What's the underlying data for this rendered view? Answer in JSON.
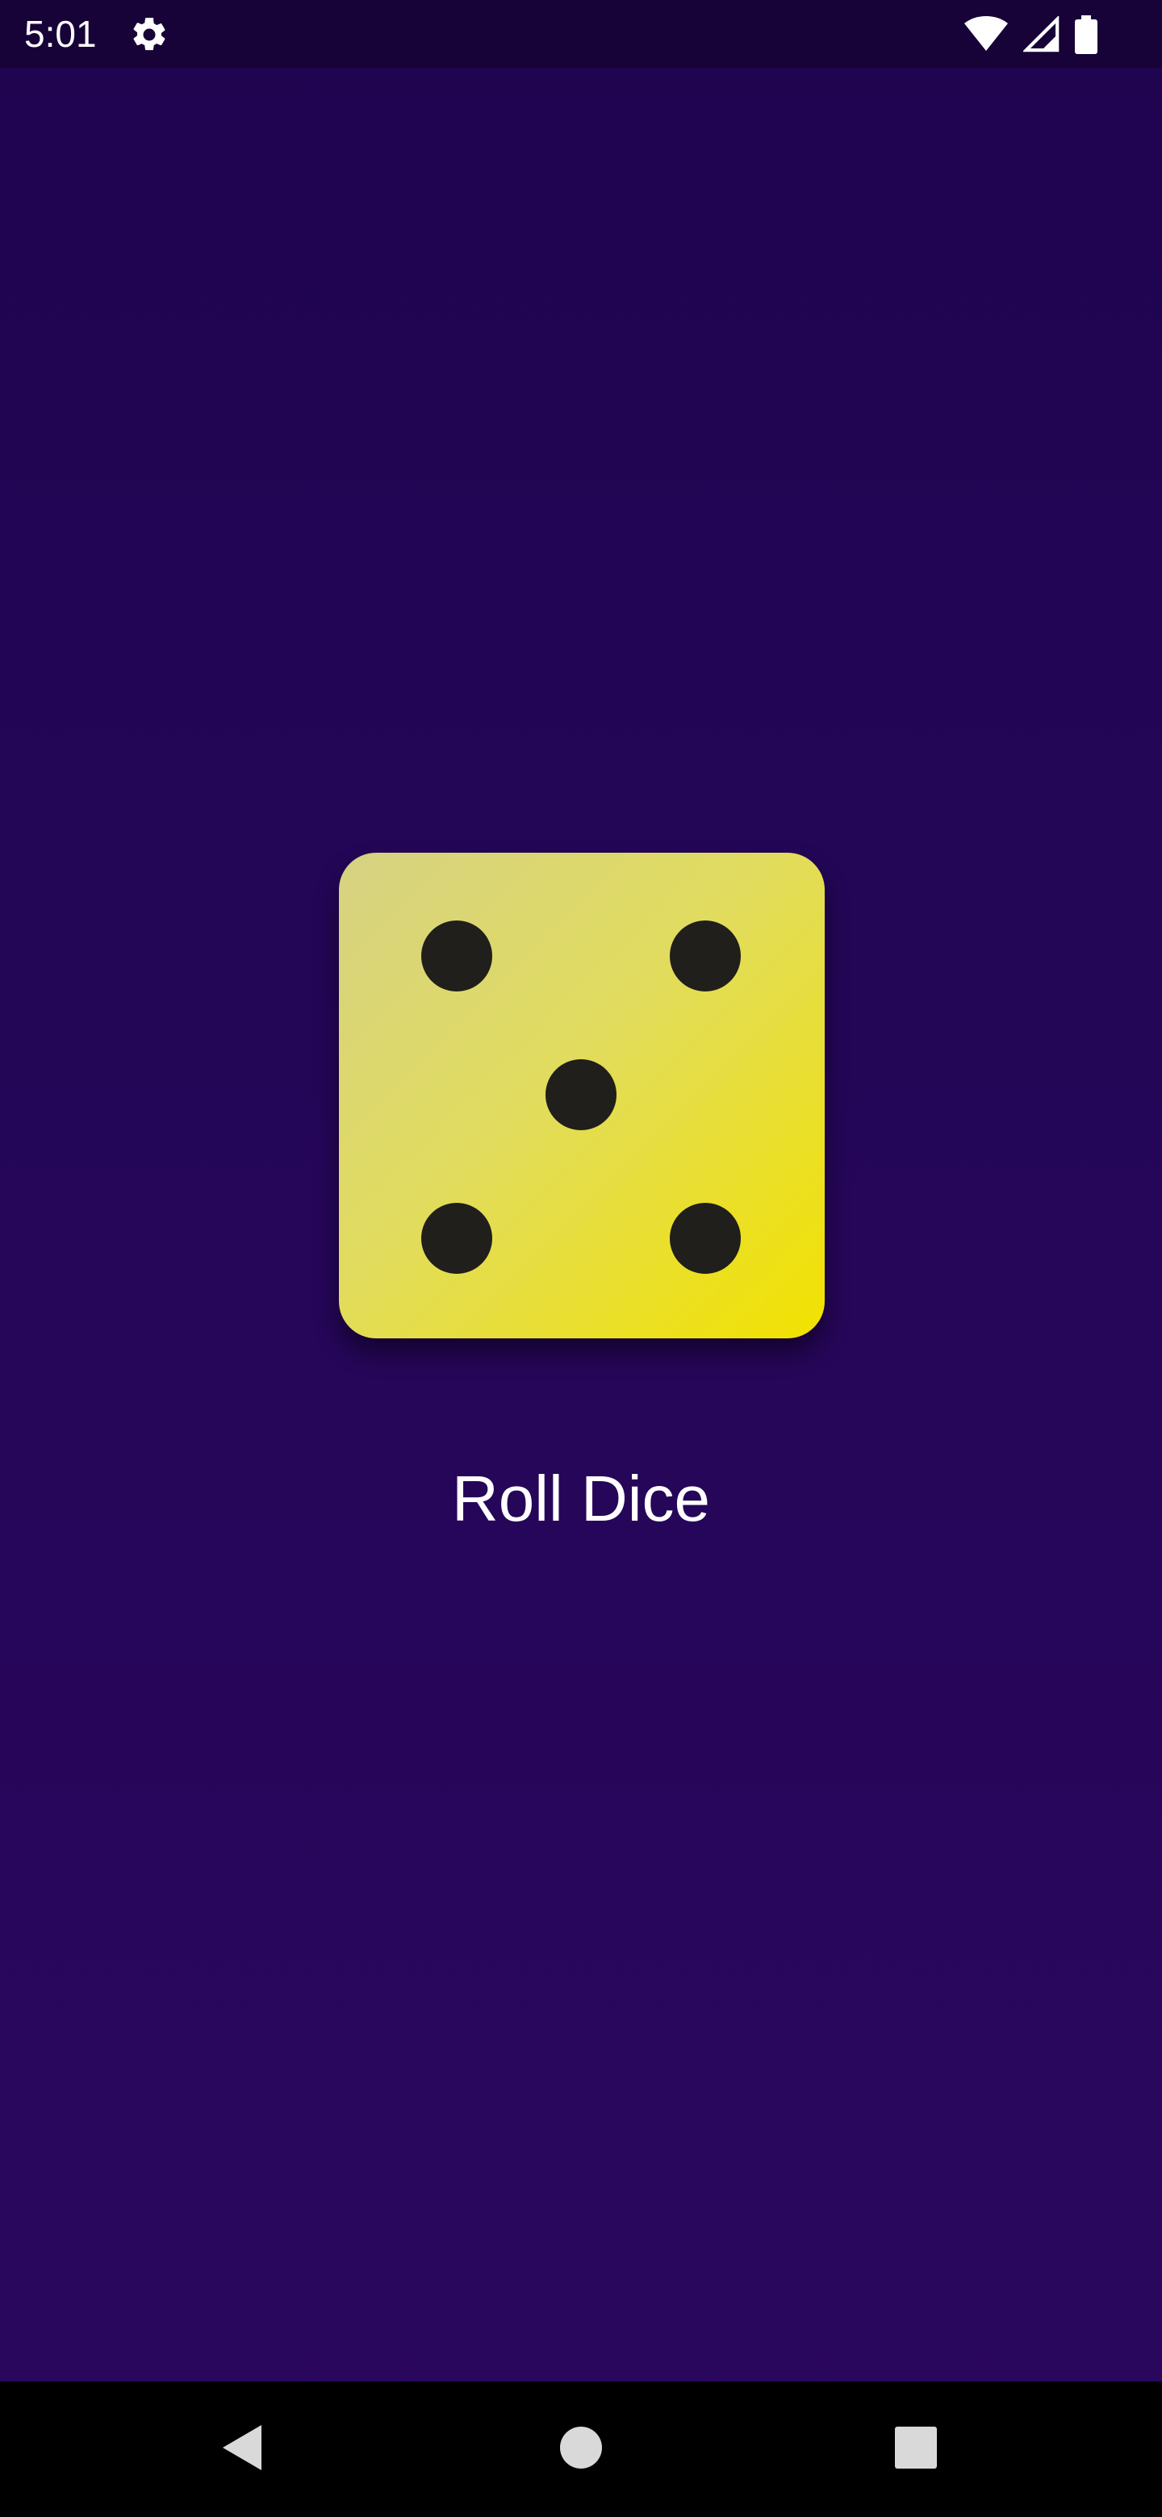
{
  "status_bar": {
    "time": "5:01",
    "icons": [
      "settings-gear-icon",
      "wifi-icon",
      "cellular-signal-icon",
      "battery-icon"
    ]
  },
  "dice": {
    "value": 5,
    "pips": [
      "top-left",
      "top-right",
      "center",
      "bottom-left",
      "bottom-right"
    ],
    "face_colors": [
      "#d6d283",
      "#f2e200"
    ],
    "pip_color": "#201f1b"
  },
  "main": {
    "roll_label": "Roll Dice"
  },
  "nav_bar": {
    "buttons": [
      "back-icon",
      "home-icon",
      "recents-icon"
    ]
  },
  "colors": {
    "background_top": "#1f0450",
    "background_bottom": "#2a075e",
    "status_bar": "#170338",
    "nav_bar": "#000000",
    "text": "#ffffff"
  }
}
